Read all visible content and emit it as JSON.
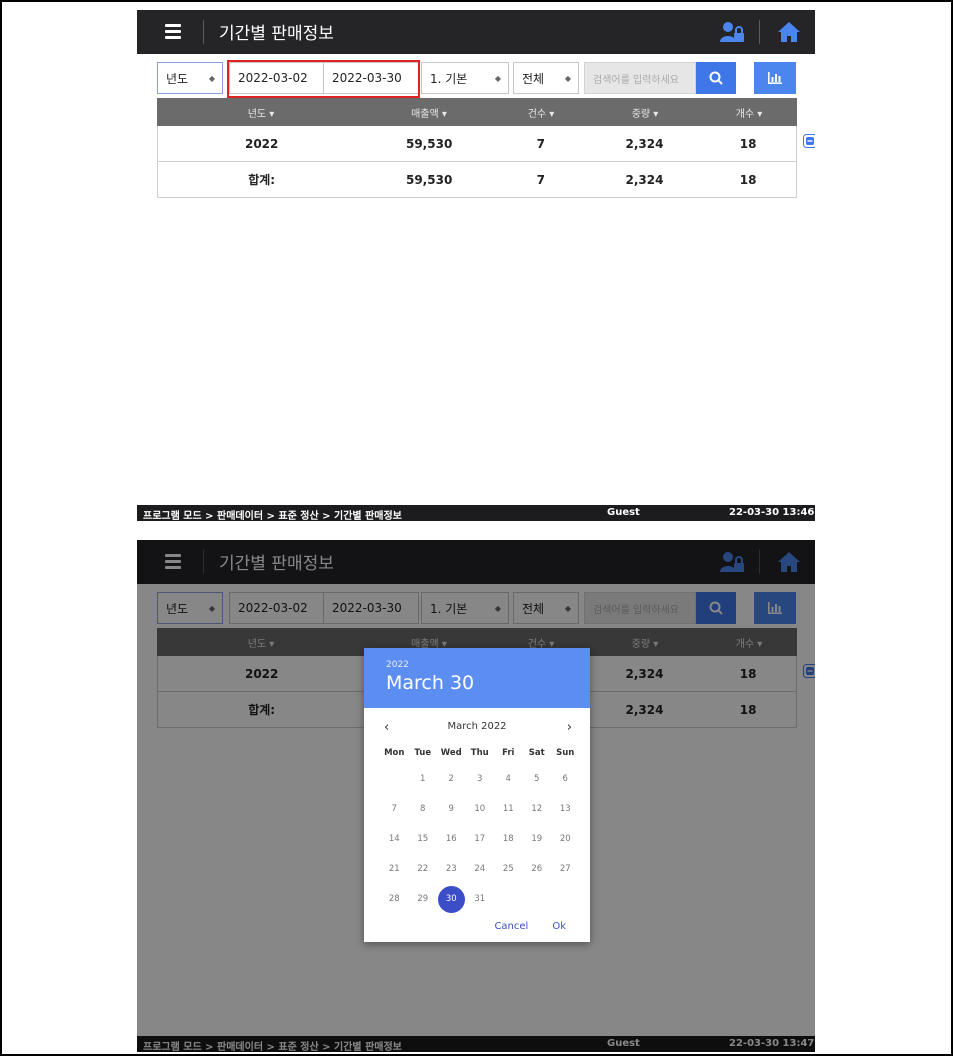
{
  "app": {
    "title": "기간별 판매정보"
  },
  "toolbar": {
    "year_select": "년도",
    "start_date": "2022-03-02",
    "end_date": "2022-03-30",
    "mode_select": "1. 기본",
    "filter_select": "전체",
    "search_placeholder": "검색어를 입력하세요"
  },
  "grid": {
    "headers": [
      "년도 ▾",
      "매출액 ▾",
      "건수 ▾",
      "중량 ▾",
      "개수 ▾"
    ],
    "rows": [
      [
        "2022",
        "59,530",
        "7",
        "2,324",
        "18"
      ],
      [
        "합계:",
        "59,530",
        "7",
        "2,324",
        "18"
      ]
    ]
  },
  "status": {
    "breadcrumb": "프로그램 모드 > 판매데이터 > 표준 정산 > 기간별 판매정보",
    "user": "Guest",
    "time_1": "22-03-30 13:46",
    "time_2": "22-03-30 13:47"
  },
  "datepicker": {
    "year": "2022",
    "selected_label": "March 30",
    "month_label": "March 2022",
    "prev": "‹",
    "next": "›",
    "weekdays": [
      "Mon",
      "Tue",
      "Wed",
      "Thu",
      "Fri",
      "Sat",
      "Sun"
    ],
    "weeks": [
      [
        "",
        "1",
        "2",
        "3",
        "4",
        "5",
        "6"
      ],
      [
        "7",
        "8",
        "9",
        "10",
        "11",
        "12",
        "13"
      ],
      [
        "14",
        "15",
        "16",
        "17",
        "18",
        "19",
        "20"
      ],
      [
        "21",
        "22",
        "23",
        "24",
        "25",
        "26",
        "27"
      ],
      [
        "28",
        "29",
        "30",
        "31",
        "",
        "",
        ""
      ]
    ],
    "selected_day": "30",
    "cancel": "Cancel",
    "ok": "Ok"
  },
  "colors": {
    "topbar": "#252528",
    "accent": "#3f77e8",
    "highlight": "#e02424",
    "picker_header": "#5b8ef0",
    "picker_selected": "#3b4ec7"
  }
}
